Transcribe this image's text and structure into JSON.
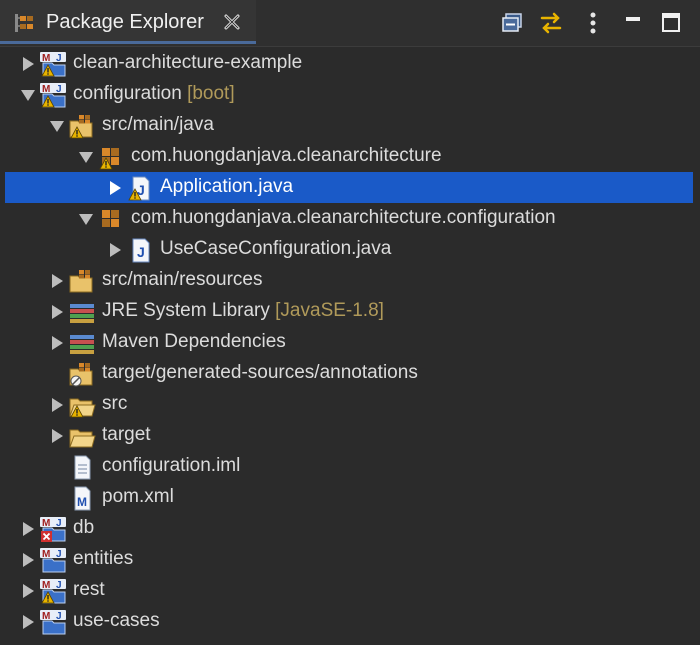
{
  "view": {
    "title": "Package Explorer",
    "toolbar": [
      "collapse-all-icon",
      "link-with-editor-icon",
      "view-menu-icon",
      "minimize-icon",
      "maximize-icon"
    ]
  },
  "tree": [
    {
      "label": "clean-architecture-example",
      "decoration": "",
      "depth": 0,
      "expanded": false,
      "icon": "maven-project-warning-icon",
      "selected": false
    },
    {
      "label": "configuration",
      "decoration": "[boot]",
      "depth": 0,
      "expanded": true,
      "icon": "maven-project-warning-icon",
      "selected": false
    },
    {
      "label": "src/main/java",
      "decoration": "",
      "depth": 1,
      "expanded": true,
      "icon": "source-folder-warning-icon",
      "selected": false
    },
    {
      "label": "com.huongdanjava.cleanarchitecture",
      "decoration": "",
      "depth": 2,
      "expanded": true,
      "icon": "package-warning-icon",
      "selected": false
    },
    {
      "label": "Application.java",
      "decoration": "",
      "depth": 3,
      "expanded": false,
      "icon": "java-file-warning-icon",
      "selected": true
    },
    {
      "label": "com.huongdanjava.cleanarchitecture.configuration",
      "decoration": "",
      "depth": 2,
      "expanded": true,
      "icon": "package-icon",
      "selected": false
    },
    {
      "label": "UseCaseConfiguration.java",
      "decoration": "",
      "depth": 3,
      "expanded": false,
      "icon": "java-file-icon",
      "selected": false
    },
    {
      "label": "src/main/resources",
      "decoration": "",
      "depth": 1,
      "expanded": false,
      "icon": "source-folder-icon",
      "selected": false
    },
    {
      "label": "JRE System Library",
      "decoration": "[JavaSE-1.8]",
      "depth": 1,
      "expanded": false,
      "icon": "library-icon",
      "selected": false
    },
    {
      "label": "Maven Dependencies",
      "decoration": "",
      "depth": 1,
      "expanded": false,
      "icon": "library-icon",
      "selected": false
    },
    {
      "label": "target/generated-sources/annotations",
      "decoration": "",
      "depth": 1,
      "expanded": null,
      "icon": "source-folder-ignored-icon",
      "selected": false
    },
    {
      "label": "src",
      "decoration": "",
      "depth": 1,
      "expanded": false,
      "icon": "folder-warning-icon",
      "selected": false
    },
    {
      "label": "target",
      "decoration": "",
      "depth": 1,
      "expanded": false,
      "icon": "folder-icon",
      "selected": false
    },
    {
      "label": "configuration.iml",
      "decoration": "",
      "depth": 1,
      "expanded": null,
      "icon": "file-icon",
      "selected": false
    },
    {
      "label": "pom.xml",
      "decoration": "",
      "depth": 1,
      "expanded": null,
      "icon": "maven-pom-icon",
      "selected": false
    },
    {
      "label": "db",
      "decoration": "",
      "depth": 0,
      "expanded": false,
      "icon": "maven-project-error-icon",
      "selected": false
    },
    {
      "label": "entities",
      "decoration": "",
      "depth": 0,
      "expanded": false,
      "icon": "maven-project-icon",
      "selected": false
    },
    {
      "label": "rest",
      "decoration": "",
      "depth": 0,
      "expanded": false,
      "icon": "maven-project-warning-icon",
      "selected": false
    },
    {
      "label": "use-cases",
      "decoration": "",
      "depth": 0,
      "expanded": false,
      "icon": "maven-project-icon",
      "selected": false
    }
  ],
  "colors": {
    "background": "#2b2b2b",
    "selection": "#1a5ac8",
    "text": "#dcdcdc",
    "decoration": "#b09a5a",
    "warning": "#e8b400",
    "error": "#d03030"
  }
}
